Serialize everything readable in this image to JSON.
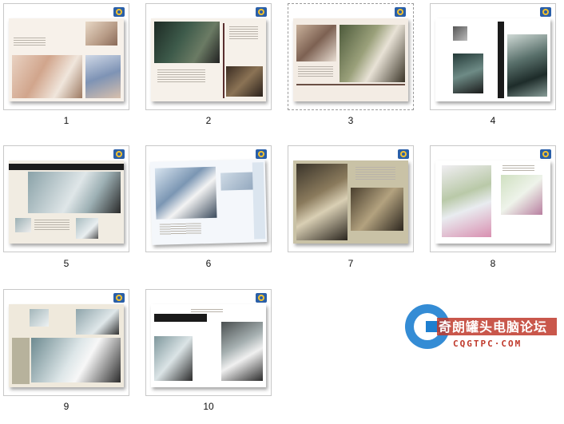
{
  "page_labels": [
    "1",
    "2",
    "3",
    "4",
    "5",
    "6",
    "7",
    "8",
    "9",
    "10"
  ],
  "selected_page": "3",
  "watermark": {
    "title": "奇朗罐头电脑论坛",
    "subtitle": "CQGTPC·COM"
  },
  "icons": {
    "page_badge": "app-globe-icon"
  },
  "colors": {
    "accent": "#1e7fd0",
    "watermark_red": "#c0392b"
  }
}
